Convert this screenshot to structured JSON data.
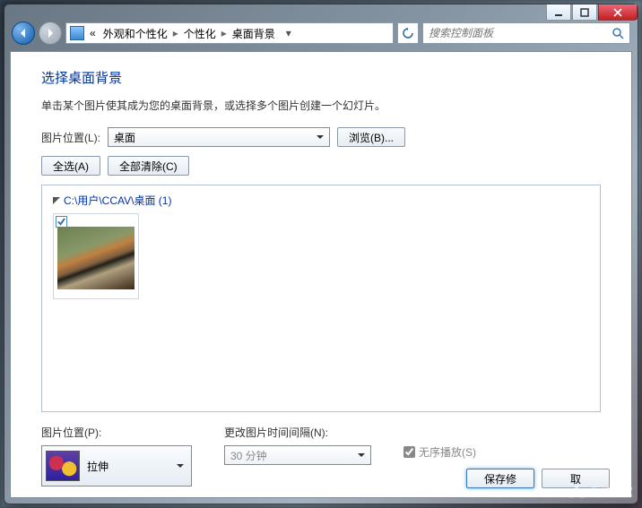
{
  "titlebar": {
    "min": "min",
    "max": "max",
    "close": "close"
  },
  "breadcrumb": {
    "prefix": "«",
    "items": [
      "外观和个性化",
      "个性化",
      "桌面背景"
    ]
  },
  "search": {
    "placeholder": "搜索控制面板"
  },
  "heading": "选择桌面背景",
  "description": "单击某个图片使其成为您的桌面背景，或选择多个图片创建一个幻灯片。",
  "location": {
    "label": "图片位置(L):",
    "value": "桌面",
    "browse": "浏览(B)..."
  },
  "actions": {
    "select_all": "全选(A)",
    "clear_all": "全部清除(C)"
  },
  "folder": {
    "path": "C:\\用户\\CCAV\\桌面 (1)"
  },
  "fit": {
    "label": "图片位置(P):",
    "value": "拉伸"
  },
  "interval": {
    "label": "更改图片时间间隔(N):",
    "value": "30 分钟"
  },
  "shuffle": {
    "label": "无序播放(S)",
    "checked": true
  },
  "footer": {
    "save": "保存修",
    "cancel": "取"
  },
  "watermark": "系统之家"
}
